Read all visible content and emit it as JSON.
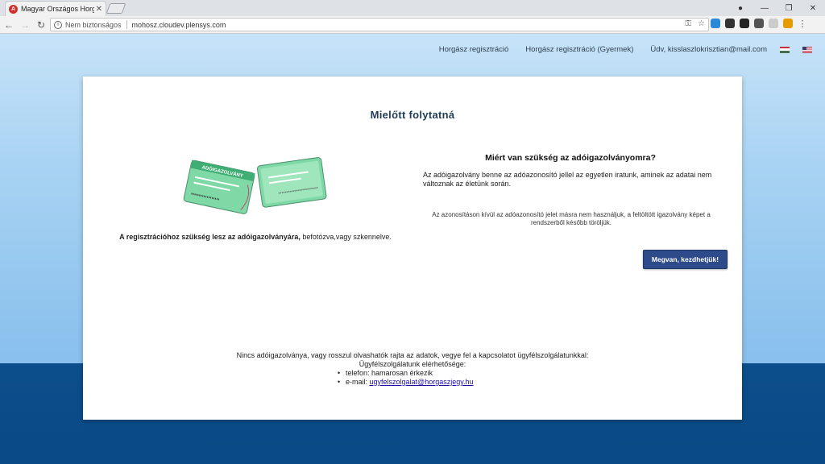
{
  "browser": {
    "tab_title": "Magyar Országos Horgász",
    "favicon_letter": "A",
    "security_label": "Nem biztonságos",
    "url": "mohosz.cloudev.plensys.com"
  },
  "nav": {
    "links": [
      "Horgász regisztráció",
      "Horgász regisztráció (Gyermek)",
      "Üdv, kisslaszlokrisztian@mail.com"
    ]
  },
  "card": {
    "title": "Mielőtt folytatná",
    "left_text_bold": "A regisztrációhoz szükség lesz az adóigazolványára,",
    "left_text_rest": " befotózva,vagy szkennelve.",
    "right_title": "Miért van szükség az adóigazolványomra?",
    "right_p1": "Az adóigazolvány benne az adóazonosító jellel az egyetlen iratunk, aminek az adatai nem változnak az életünk során.",
    "right_p2": "Az azonosításon kívül az adóazonosító jelet másra nem használjuk, a feltöltött igazolvány képet a rendszerből később töröljük.",
    "button_label": "Megvan, kezdhetjük!",
    "card_label": "ADÓIGAZOLVÁNY"
  },
  "footer": {
    "line1": "Nincs adóigazolványa, vagy rosszul olvashatók rajta az adatok, vegye fel a kapcsolatot ügyfélszolgálatunkkal:",
    "line2": "Ügyfélszolgálatunk elérhetősége:",
    "phone": "telefon: hamarosan érkezik",
    "email_label": "e-mail: ",
    "email": "ugyfelszolgalat@horgaszjegy.hu"
  },
  "colors": {
    "button": "#2d4a8a",
    "title": "#1f3b57",
    "card_green": "#7fd9a6"
  }
}
